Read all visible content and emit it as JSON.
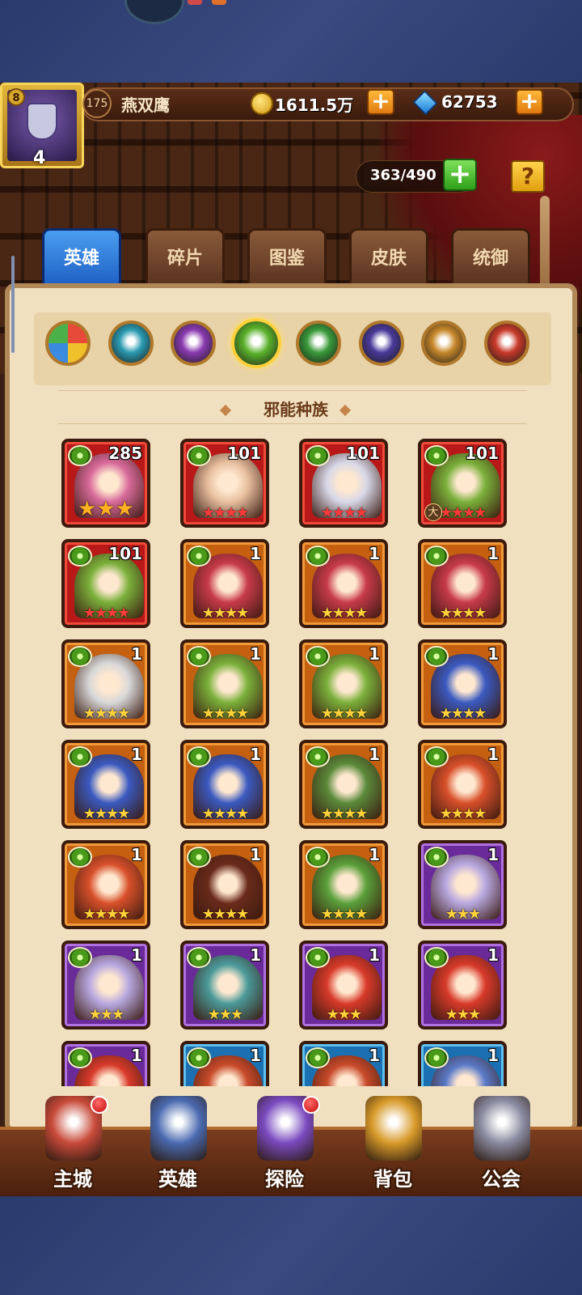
{
  "status": {
    "left_text": "",
    "right_text": ""
  },
  "player": {
    "vip": "8",
    "vip_level": "4",
    "level": "175",
    "name": "燕双鹰"
  },
  "resources": {
    "gold": "1611.5万",
    "gems": "62753"
  },
  "capacity": "363/490",
  "help_label": "?",
  "tabs": [
    {
      "label": "英雄",
      "active": true
    },
    {
      "label": "碎片",
      "active": false
    },
    {
      "label": "图鉴",
      "active": false
    },
    {
      "label": "皮肤",
      "active": false
    },
    {
      "label": "统御",
      "active": false
    }
  ],
  "race_filters": [
    {
      "name": "all-races-icon",
      "colors": [
        "#e84a3a",
        "#3a8ae0"
      ]
    },
    {
      "name": "fortress-race-icon",
      "color": "#2a9ab0"
    },
    {
      "name": "abyss-race-icon",
      "color": "#8a3ab0"
    },
    {
      "name": "dark-race-icon",
      "color": "#5ab02a",
      "selected": true
    },
    {
      "name": "forest-race-icon",
      "color": "#3a9a3a"
    },
    {
      "name": "shadow-race-icon",
      "color": "#4a3a9a"
    },
    {
      "name": "light-race-icon",
      "color": "#c8882a"
    },
    {
      "name": "chaos-race-icon",
      "color": "#c83a2a"
    }
  ],
  "race_title": "邪能种族",
  "heroes": [
    {
      "level": "285",
      "rarity": "red",
      "stars": "★★★",
      "star_style": "big",
      "portrait": "#d86a9a"
    },
    {
      "level": "101",
      "rarity": "red",
      "stars": "★★★★",
      "star_style": "red",
      "portrait": "#e8c0a0"
    },
    {
      "level": "101",
      "rarity": "red",
      "stars": "★★★★",
      "star_style": "red",
      "portrait": "#d8d8e8"
    },
    {
      "level": "101",
      "rarity": "red",
      "stars": "★★★★",
      "star_style": "red",
      "portrait": "#7ab03a",
      "awaken": "大"
    },
    {
      "level": "101",
      "rarity": "red",
      "stars": "★★★★",
      "star_style": "red",
      "portrait": "#7ab03a"
    },
    {
      "level": "1",
      "rarity": "orange",
      "stars": "★★★★",
      "star_style": "gold",
      "portrait": "#c83a4a"
    },
    {
      "level": "1",
      "rarity": "orange",
      "stars": "★★★★",
      "star_style": "gold",
      "portrait": "#c83a4a"
    },
    {
      "level": "1",
      "rarity": "orange",
      "stars": "★★★★",
      "star_style": "gold",
      "portrait": "#c83a4a"
    },
    {
      "level": "1",
      "rarity": "orange",
      "stars": "★★★★",
      "star_style": "gold",
      "portrait": "#d8d8d8"
    },
    {
      "level": "1",
      "rarity": "orange",
      "stars": "★★★★",
      "star_style": "gold",
      "portrait": "#7ab03a"
    },
    {
      "level": "1",
      "rarity": "orange",
      "stars": "★★★★",
      "star_style": "gold",
      "portrait": "#7ab03a"
    },
    {
      "level": "1",
      "rarity": "orange",
      "stars": "★★★★",
      "star_style": "gold",
      "portrait": "#3a5ac0"
    },
    {
      "level": "1",
      "rarity": "orange",
      "stars": "★★★★",
      "star_style": "gold",
      "portrait": "#3a5ac0"
    },
    {
      "level": "1",
      "rarity": "orange",
      "stars": "★★★★",
      "star_style": "gold",
      "portrait": "#3a5ac0"
    },
    {
      "level": "1",
      "rarity": "orange",
      "stars": "★★★★",
      "star_style": "gold",
      "portrait": "#5a8a3a"
    },
    {
      "level": "1",
      "rarity": "orange",
      "stars": "★★★★",
      "star_style": "gold",
      "portrait": "#d8502a"
    },
    {
      "level": "1",
      "rarity": "orange",
      "stars": "★★★★",
      "star_style": "gold",
      "portrait": "#d8502a"
    },
    {
      "level": "1",
      "rarity": "orange",
      "stars": "★★★★",
      "star_style": "gold",
      "portrait": "#6a2a1a"
    },
    {
      "level": "1",
      "rarity": "orange",
      "stars": "★★★★",
      "star_style": "gold",
      "portrait": "#5aa03a"
    },
    {
      "level": "1",
      "rarity": "purple",
      "stars": "★★★",
      "star_style": "gold",
      "portrait": "#b8a8e0"
    },
    {
      "level": "1",
      "rarity": "purple",
      "stars": "★★★",
      "star_style": "gold",
      "portrait": "#b8a8e0"
    },
    {
      "level": "1",
      "rarity": "purple",
      "stars": "★★★",
      "star_style": "gold",
      "portrait": "#4a9a9a"
    },
    {
      "level": "1",
      "rarity": "purple",
      "stars": "★★★",
      "star_style": "gold",
      "portrait": "#d83a2a"
    },
    {
      "level": "1",
      "rarity": "purple",
      "stars": "★★★",
      "star_style": "gold",
      "portrait": "#d83a2a"
    },
    {
      "level": "1",
      "rarity": "purple",
      "stars": "",
      "star_style": "gold",
      "portrait": "#d83a2a"
    },
    {
      "level": "1",
      "rarity": "blue",
      "stars": "",
      "star_style": "gold",
      "portrait": "#c84a2a"
    },
    {
      "level": "1",
      "rarity": "blue",
      "stars": "",
      "star_style": "gold",
      "portrait": "#c84a2a"
    },
    {
      "level": "1",
      "rarity": "blue",
      "stars": "",
      "star_style": "gold",
      "portrait": "#5a7ac8"
    }
  ],
  "nav": [
    {
      "label": "主城",
      "icon": "castle-icon",
      "color": "#c84a3a",
      "badge": true
    },
    {
      "label": "英雄",
      "icon": "hero-icon",
      "color": "#4a6ab0",
      "badge": false
    },
    {
      "label": "探险",
      "icon": "portal-icon",
      "color": "#7a4ac0",
      "badge": true
    },
    {
      "label": "背包",
      "icon": "backpack-icon",
      "color": "#d89a2a",
      "badge": false
    },
    {
      "label": "公会",
      "icon": "guild-tower-icon",
      "color": "#8a8aa0",
      "badge": false
    }
  ]
}
